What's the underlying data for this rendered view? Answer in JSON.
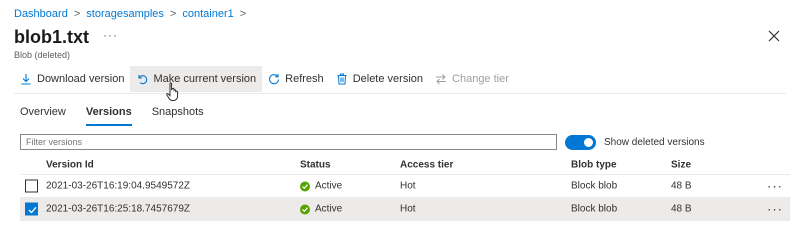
{
  "breadcrumb": {
    "items": [
      "Dashboard",
      "storagesamples",
      "container1"
    ],
    "separator": ">"
  },
  "header": {
    "title": "blob1.txt",
    "more": "···",
    "subtitle": "Blob (deleted)"
  },
  "toolbar": {
    "download_label": "Download version",
    "make_current_label": "Make current version",
    "refresh_label": "Refresh",
    "delete_label": "Delete version",
    "change_tier_label": "Change tier"
  },
  "tabs": [
    {
      "label": "Overview"
    },
    {
      "label": "Versions"
    },
    {
      "label": "Snapshots"
    }
  ],
  "filter": {
    "placeholder": "Filter versions"
  },
  "toggle": {
    "label": "Show deleted versions",
    "on": true
  },
  "table": {
    "headers": {
      "version_id": "Version Id",
      "status": "Status",
      "access_tier": "Access tier",
      "blob_type": "Blob type",
      "size": "Size"
    },
    "rows": [
      {
        "version_id": "2021-03-26T16:19:04.9549572Z",
        "status": "Active",
        "access_tier": "Hot",
        "blob_type": "Block blob",
        "size": "48 B",
        "selected": false,
        "more": "···"
      },
      {
        "version_id": "2021-03-26T16:25:18.7457679Z",
        "status": "Active",
        "access_tier": "Hot",
        "blob_type": "Block blob",
        "size": "48 B",
        "selected": true,
        "more": "···"
      }
    ]
  },
  "colors": {
    "accent": "#0078d4",
    "status_active": "#57a300",
    "selected_row": "#edebe9"
  },
  "icons": [
    "download-icon",
    "undo-icon",
    "refresh-icon",
    "trash-icon",
    "swap-icon",
    "close-icon",
    "check-icon",
    "pointer-cursor-icon"
  ]
}
